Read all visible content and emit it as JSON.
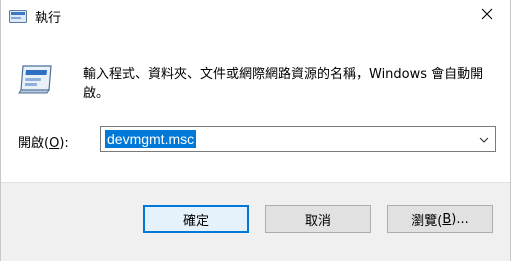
{
  "window": {
    "title": "執行",
    "title_icon": "run-icon"
  },
  "controls": {
    "close_icon": "close-icon"
  },
  "description": "輸入程式、資料夾、文件或網際網路資源的名稱，Windows 會自動開啟。",
  "open": {
    "label": "開啟(",
    "accelerator": "O",
    "label_suffix": "):",
    "value": "devmgmt.msc",
    "dropdown_icon": "chevron-down-icon"
  },
  "buttons": {
    "ok": "確定",
    "cancel": "取消",
    "browse_prefix": "瀏覽(",
    "browse_accelerator": "B",
    "browse_suffix": ")..."
  },
  "colors": {
    "accent": "#0078d7",
    "footer_bg": "#f0f0f0",
    "button_bg": "#e1e1e1"
  }
}
